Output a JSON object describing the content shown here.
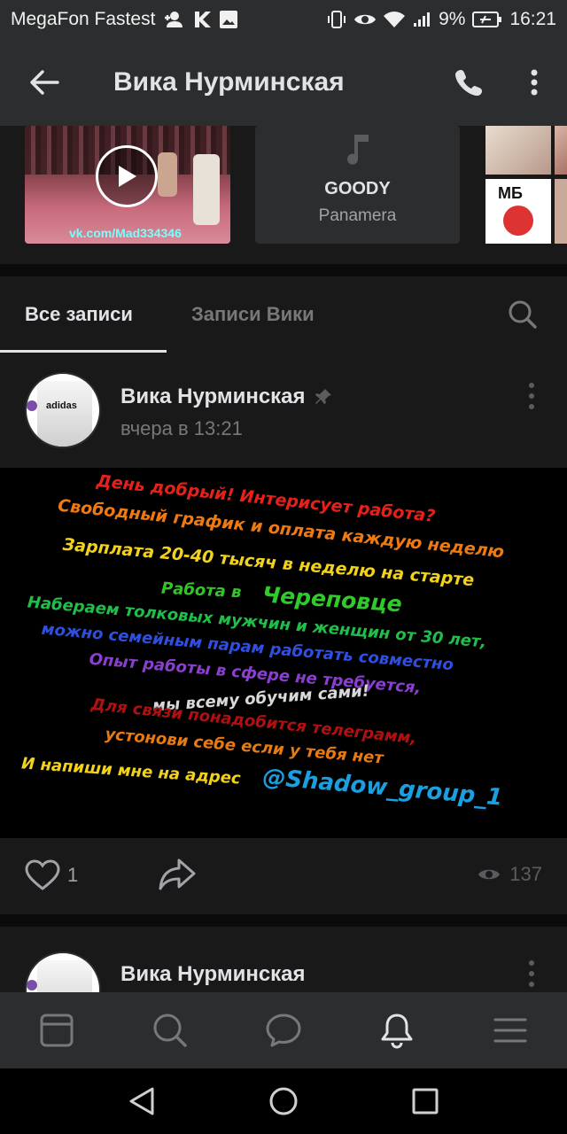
{
  "status_bar": {
    "carrier": "MegaFon Fastest",
    "battery": "9%",
    "time": "16:21"
  },
  "header": {
    "title": "Вика Нурминская"
  },
  "media": {
    "video_watermark": "vk.com/Mad334346",
    "audio": {
      "artist": "GOODY",
      "track": "Panamera"
    },
    "photo_label": "МБ"
  },
  "tabs": {
    "all_posts": "Все записи",
    "user_posts": "Записи Вики"
  },
  "posts": [
    {
      "author": "Вика Нурминская",
      "time": "вчера в 13:21",
      "avatar_brand": "adidas",
      "image_text": [
        "День добрый! Интерисует работа?",
        "Свободный график и оплата каждую неделю",
        "Зарплата 20-40 тысяч в неделю на старте",
        "Работа в",
        "Череповце",
        "Набераем толковых мужчин и женщин от 30 лет,",
        "можно семейным парам работать совместно",
        "Опыт работы в сфере не требуется,",
        "мы всему обучим сами!",
        "Для связи понадобится телеграмм,",
        "устонови себе если у тебя нет",
        "И напиши мне на адрес",
        "@Shadow_group_1"
      ],
      "likes": "1",
      "views": "137"
    },
    {
      "author": "Вика Нурминская"
    }
  ],
  "colors": {
    "background": "#0a0a0a",
    "card": "#19191a",
    "bar": "#2c2d2e",
    "text": "#e1e3e6",
    "muted": "#76787a"
  }
}
